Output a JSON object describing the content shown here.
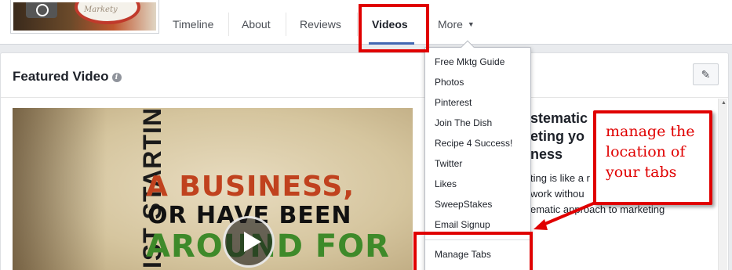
{
  "tabs": {
    "items": [
      {
        "label": "Timeline"
      },
      {
        "label": "About"
      },
      {
        "label": "Reviews"
      },
      {
        "label": "Videos"
      }
    ],
    "more_label": "More",
    "more_caret": "▼",
    "active": "Videos"
  },
  "profile": {
    "plate_text": "Markety"
  },
  "card": {
    "title": "Featured Video",
    "info_icon": "i",
    "edit_icon": "✎"
  },
  "video": {
    "vertical_text": "IST STARTING",
    "line1": "A BUSINESS,",
    "line2": "OR HAVE BEEN",
    "line3": "AROUND FOR"
  },
  "video_info": {
    "title": "stematic\neting yo\nness",
    "description": "ting is like a r\nwork withou\nematic approach to marketing"
  },
  "dropdown": {
    "items": [
      "Free Mktg Guide",
      "Photos",
      "Pinterest",
      "Join The Dish",
      "Recipe 4 Success!",
      "Twitter",
      "Likes",
      "SweepStakes",
      "Email Signup",
      "Manage Tabs"
    ]
  },
  "callout": {
    "text": "manage the location of your tabs"
  },
  "colors": {
    "highlight_red": "#e00000",
    "accent_blue": "#4267b2"
  }
}
